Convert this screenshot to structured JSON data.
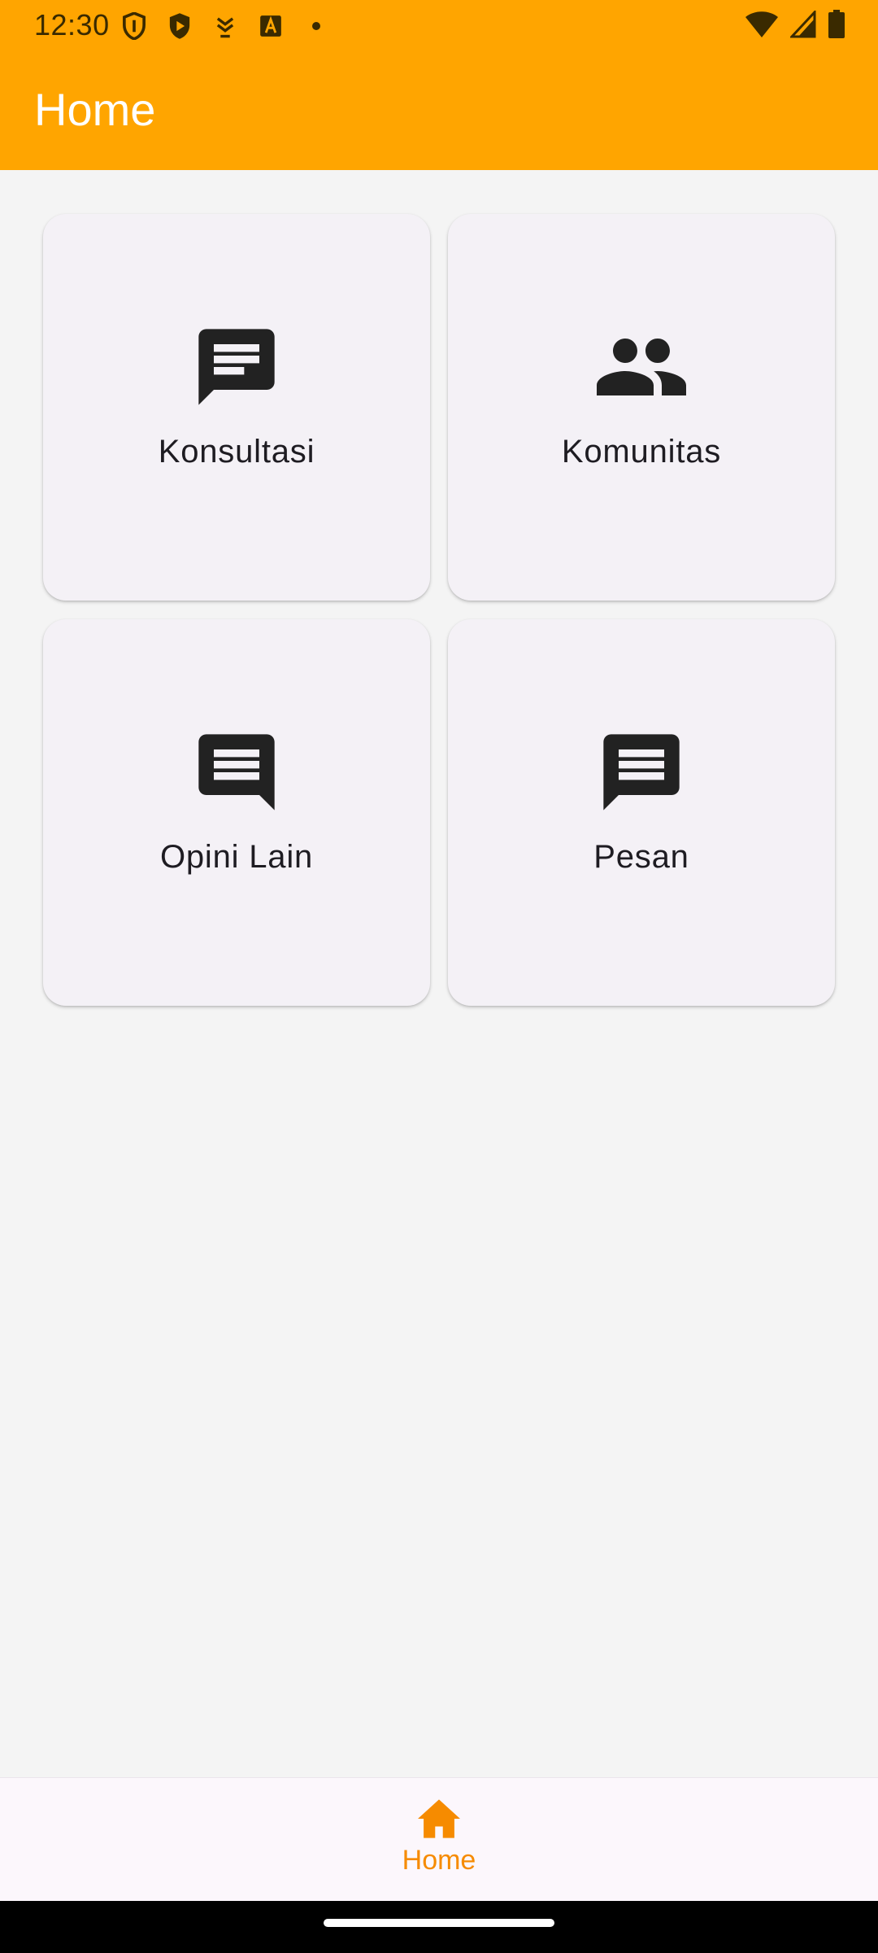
{
  "status_bar": {
    "time": "12:30",
    "left_icons": [
      "shield-outline-icon",
      "play-shield-icon",
      "download-app-icon",
      "text-a-icon",
      "dot-icon"
    ],
    "right_icons": [
      "wifi-icon",
      "cell-signal-icon",
      "battery-icon"
    ]
  },
  "app_bar": {
    "title": "Home",
    "color": "#FFA500"
  },
  "grid": {
    "cards": [
      {
        "label": "Konsultasi",
        "icon": "chat-bubble-text-icon"
      },
      {
        "label": "Komunitas",
        "icon": "people-icon"
      },
      {
        "label": "Opini Lain",
        "icon": "chat-bubble-lines-icon"
      },
      {
        "label": "Pesan",
        "icon": "chat-bubble-lines-icon"
      }
    ]
  },
  "bottom_nav": {
    "items": [
      {
        "label": "Home",
        "icon": "home-icon",
        "active": true
      }
    ],
    "active_color": "#F68B00"
  }
}
